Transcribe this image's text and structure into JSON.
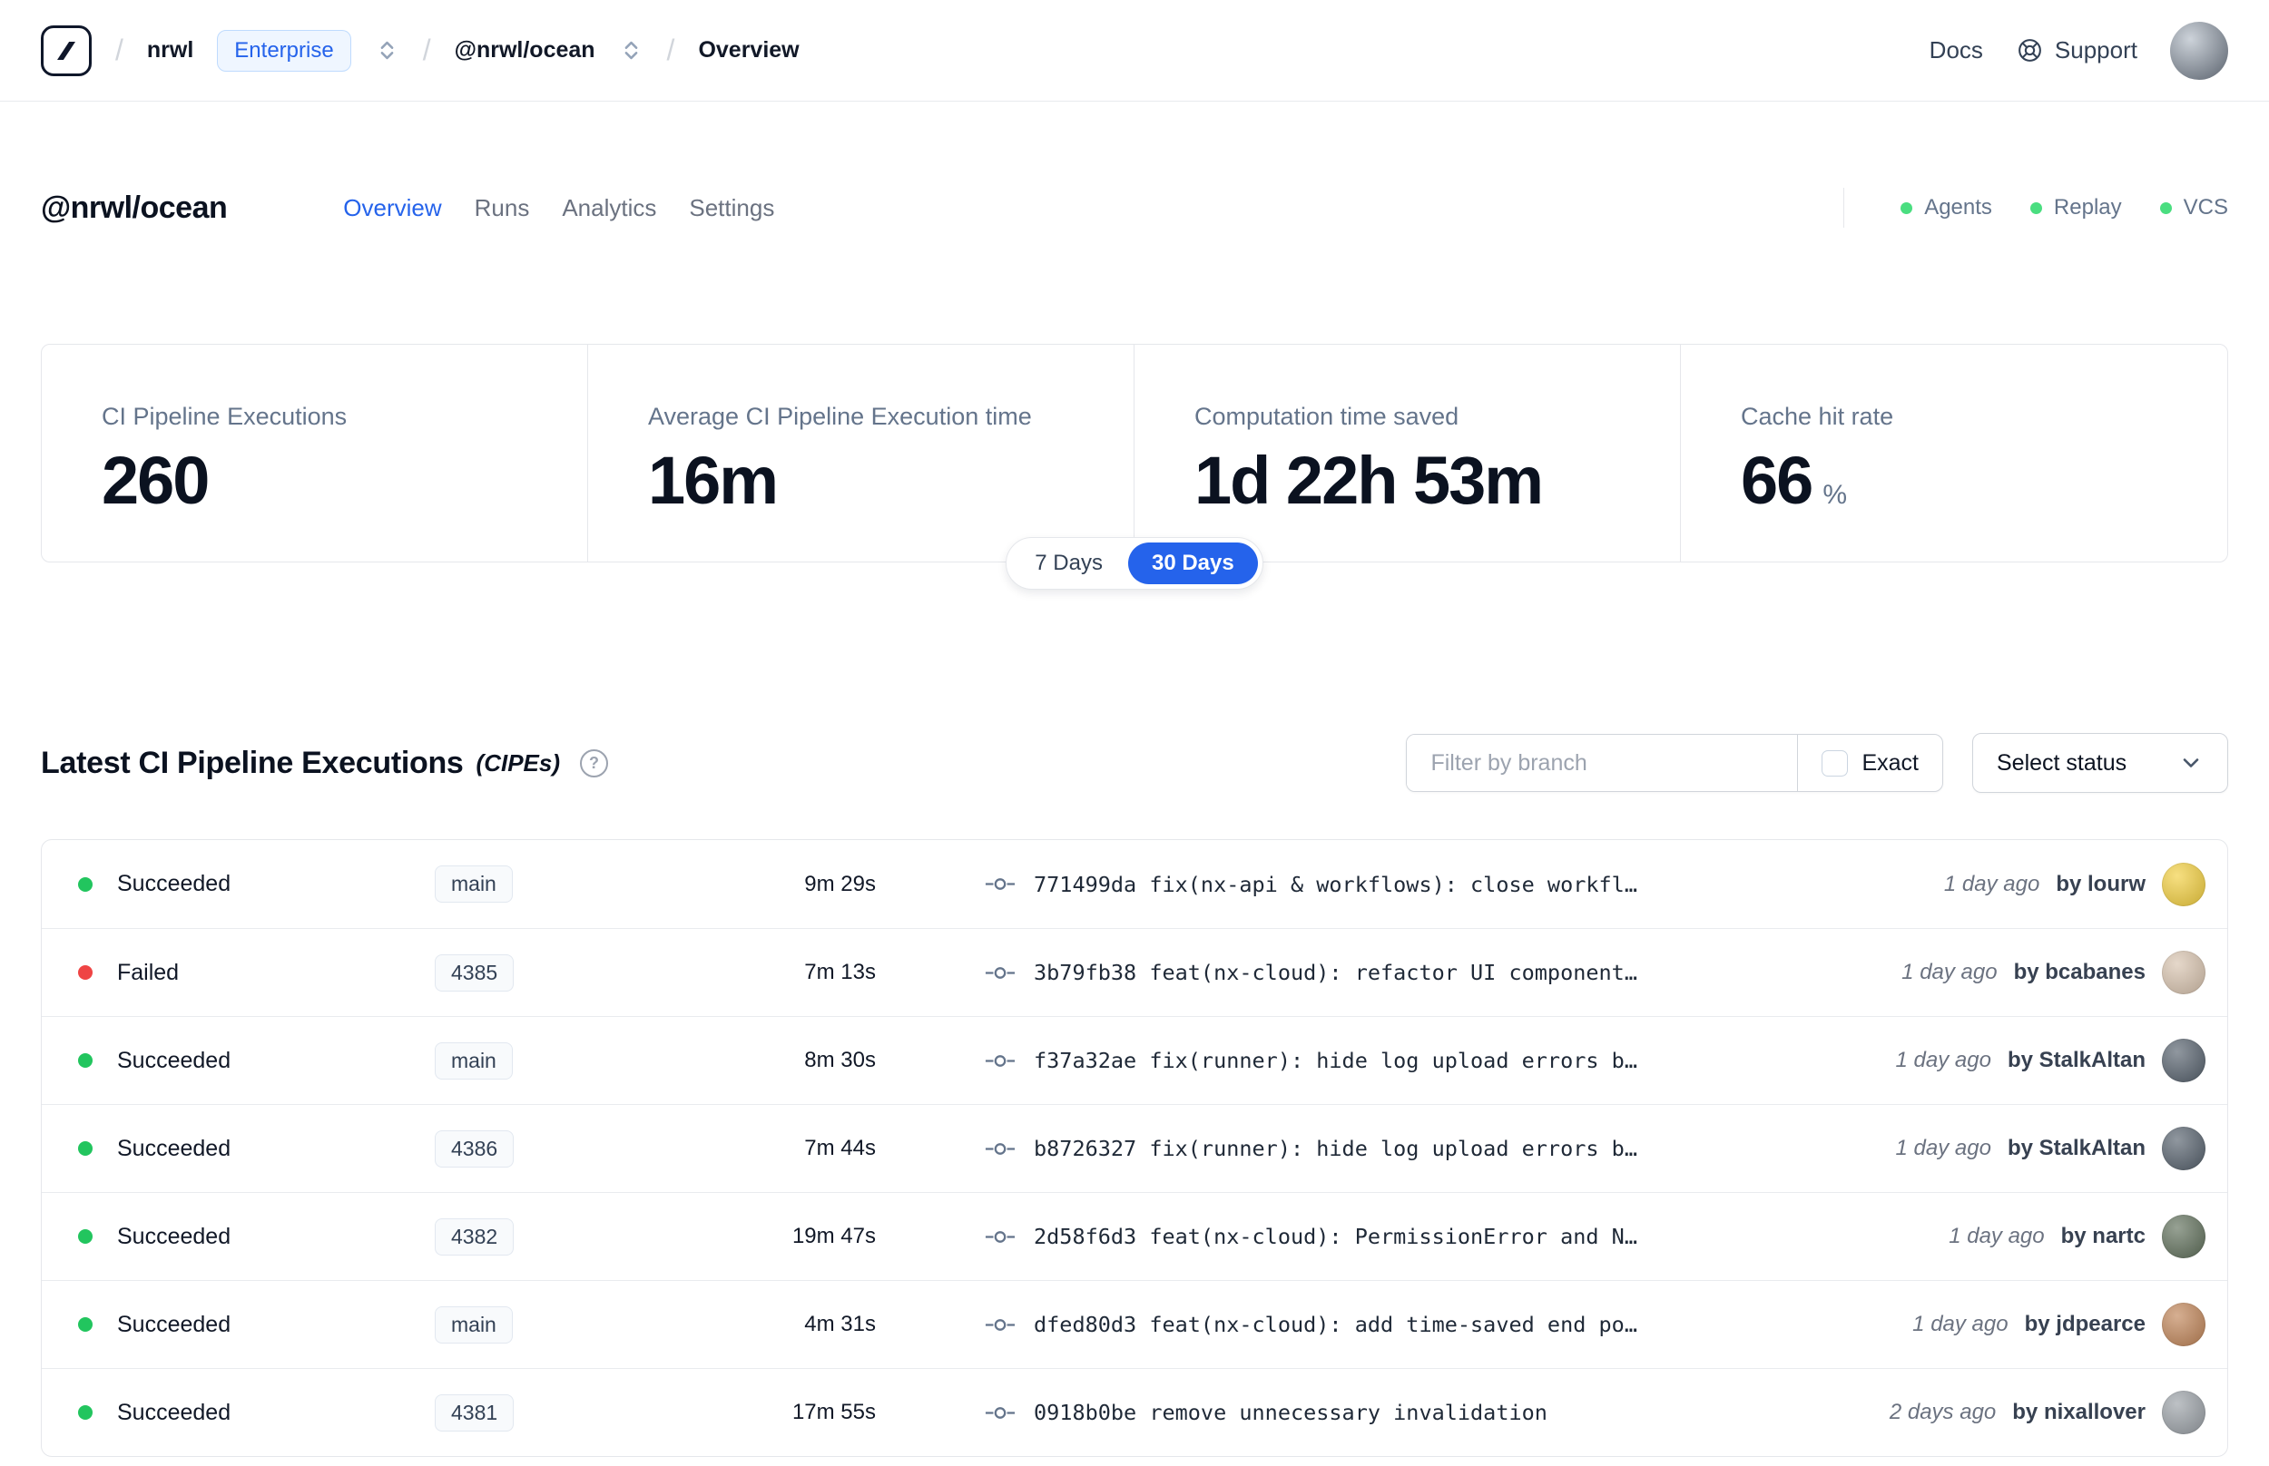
{
  "colors": {
    "accent": "#2563eb",
    "succeeded": "#22c55e",
    "failed": "#ef4444",
    "header_status_dot": "#4ade80"
  },
  "topnav": {
    "breadcrumb": {
      "separator": "/",
      "org": "nrwl",
      "org_badge": "Enterprise",
      "workspace": "@nrwl/ocean",
      "page": "Overview"
    },
    "docs_label": "Docs",
    "support_label": "Support"
  },
  "header": {
    "title": "@nrwl/ocean",
    "tabs": [
      {
        "label": "Overview",
        "active": true
      },
      {
        "label": "Runs",
        "active": false
      },
      {
        "label": "Analytics",
        "active": false
      },
      {
        "label": "Settings",
        "active": false
      }
    ],
    "statuses": [
      {
        "label": "Agents"
      },
      {
        "label": "Replay"
      },
      {
        "label": "VCS"
      }
    ]
  },
  "stats": {
    "cards": [
      {
        "label": "CI Pipeline Executions",
        "value": "260"
      },
      {
        "label": "Average CI Pipeline Execution time",
        "value": "16m"
      },
      {
        "label": "Computation time saved",
        "value": "1d 22h 53m"
      },
      {
        "label": "Cache hit rate",
        "value": "66",
        "suffix": "%"
      }
    ],
    "range_toggle": [
      {
        "label": "7 Days",
        "active": false
      },
      {
        "label": "30 Days",
        "active": true
      }
    ]
  },
  "cipes": {
    "title": "Latest CI Pipeline Executions",
    "title_suffix": "(CIPEs)",
    "help_icon": "?",
    "filter_placeholder": "Filter by branch",
    "exact_label": "Exact",
    "exact_checked": false,
    "status_select_label": "Select status",
    "rows": [
      {
        "status": "Succeeded",
        "branch": "main",
        "duration": "9m 29s",
        "commit": "771499da fix(nx-api & workflows): close workfl…",
        "time_ago": "1 day ago",
        "author": "by lourw",
        "avatar_color": "#f3cf3e"
      },
      {
        "status": "Failed",
        "branch": "4385",
        "duration": "7m 13s",
        "commit": "3b79fb38 feat(nx-cloud): refactor UI component…",
        "time_ago": "1 day ago",
        "author": "by bcabanes",
        "avatar_color": "#d8c3ae"
      },
      {
        "status": "Succeeded",
        "branch": "main",
        "duration": "8m 30s",
        "commit": "f37a32ae fix(runner): hide log upload errors b…",
        "time_ago": "1 day ago",
        "author": "by StalkAltan",
        "avatar_color": "#55606c"
      },
      {
        "status": "Succeeded",
        "branch": "4386",
        "duration": "7m 44s",
        "commit": "b8726327 fix(runner): hide log upload errors b…",
        "time_ago": "1 day ago",
        "author": "by StalkAltan",
        "avatar_color": "#55606c"
      },
      {
        "status": "Succeeded",
        "branch": "4382",
        "duration": "19m 47s",
        "commit": "2d58f6d3 feat(nx-cloud): PermissionError and N…",
        "time_ago": "1 day ago",
        "author": "by nartc",
        "avatar_color": "#5f6f5a"
      },
      {
        "status": "Succeeded",
        "branch": "main",
        "duration": "4m 31s",
        "commit": "dfed80d3 feat(nx-cloud): add time-saved end po…",
        "time_ago": "1 day ago",
        "author": "by jdpearce",
        "avatar_color": "#c08457"
      },
      {
        "status": "Succeeded",
        "branch": "4381",
        "duration": "17m 55s",
        "commit": "0918b0be remove unnecessary invalidation",
        "time_ago": "2 days ago",
        "author": "by nixallover",
        "avatar_color": "#9aa0a6"
      }
    ]
  }
}
